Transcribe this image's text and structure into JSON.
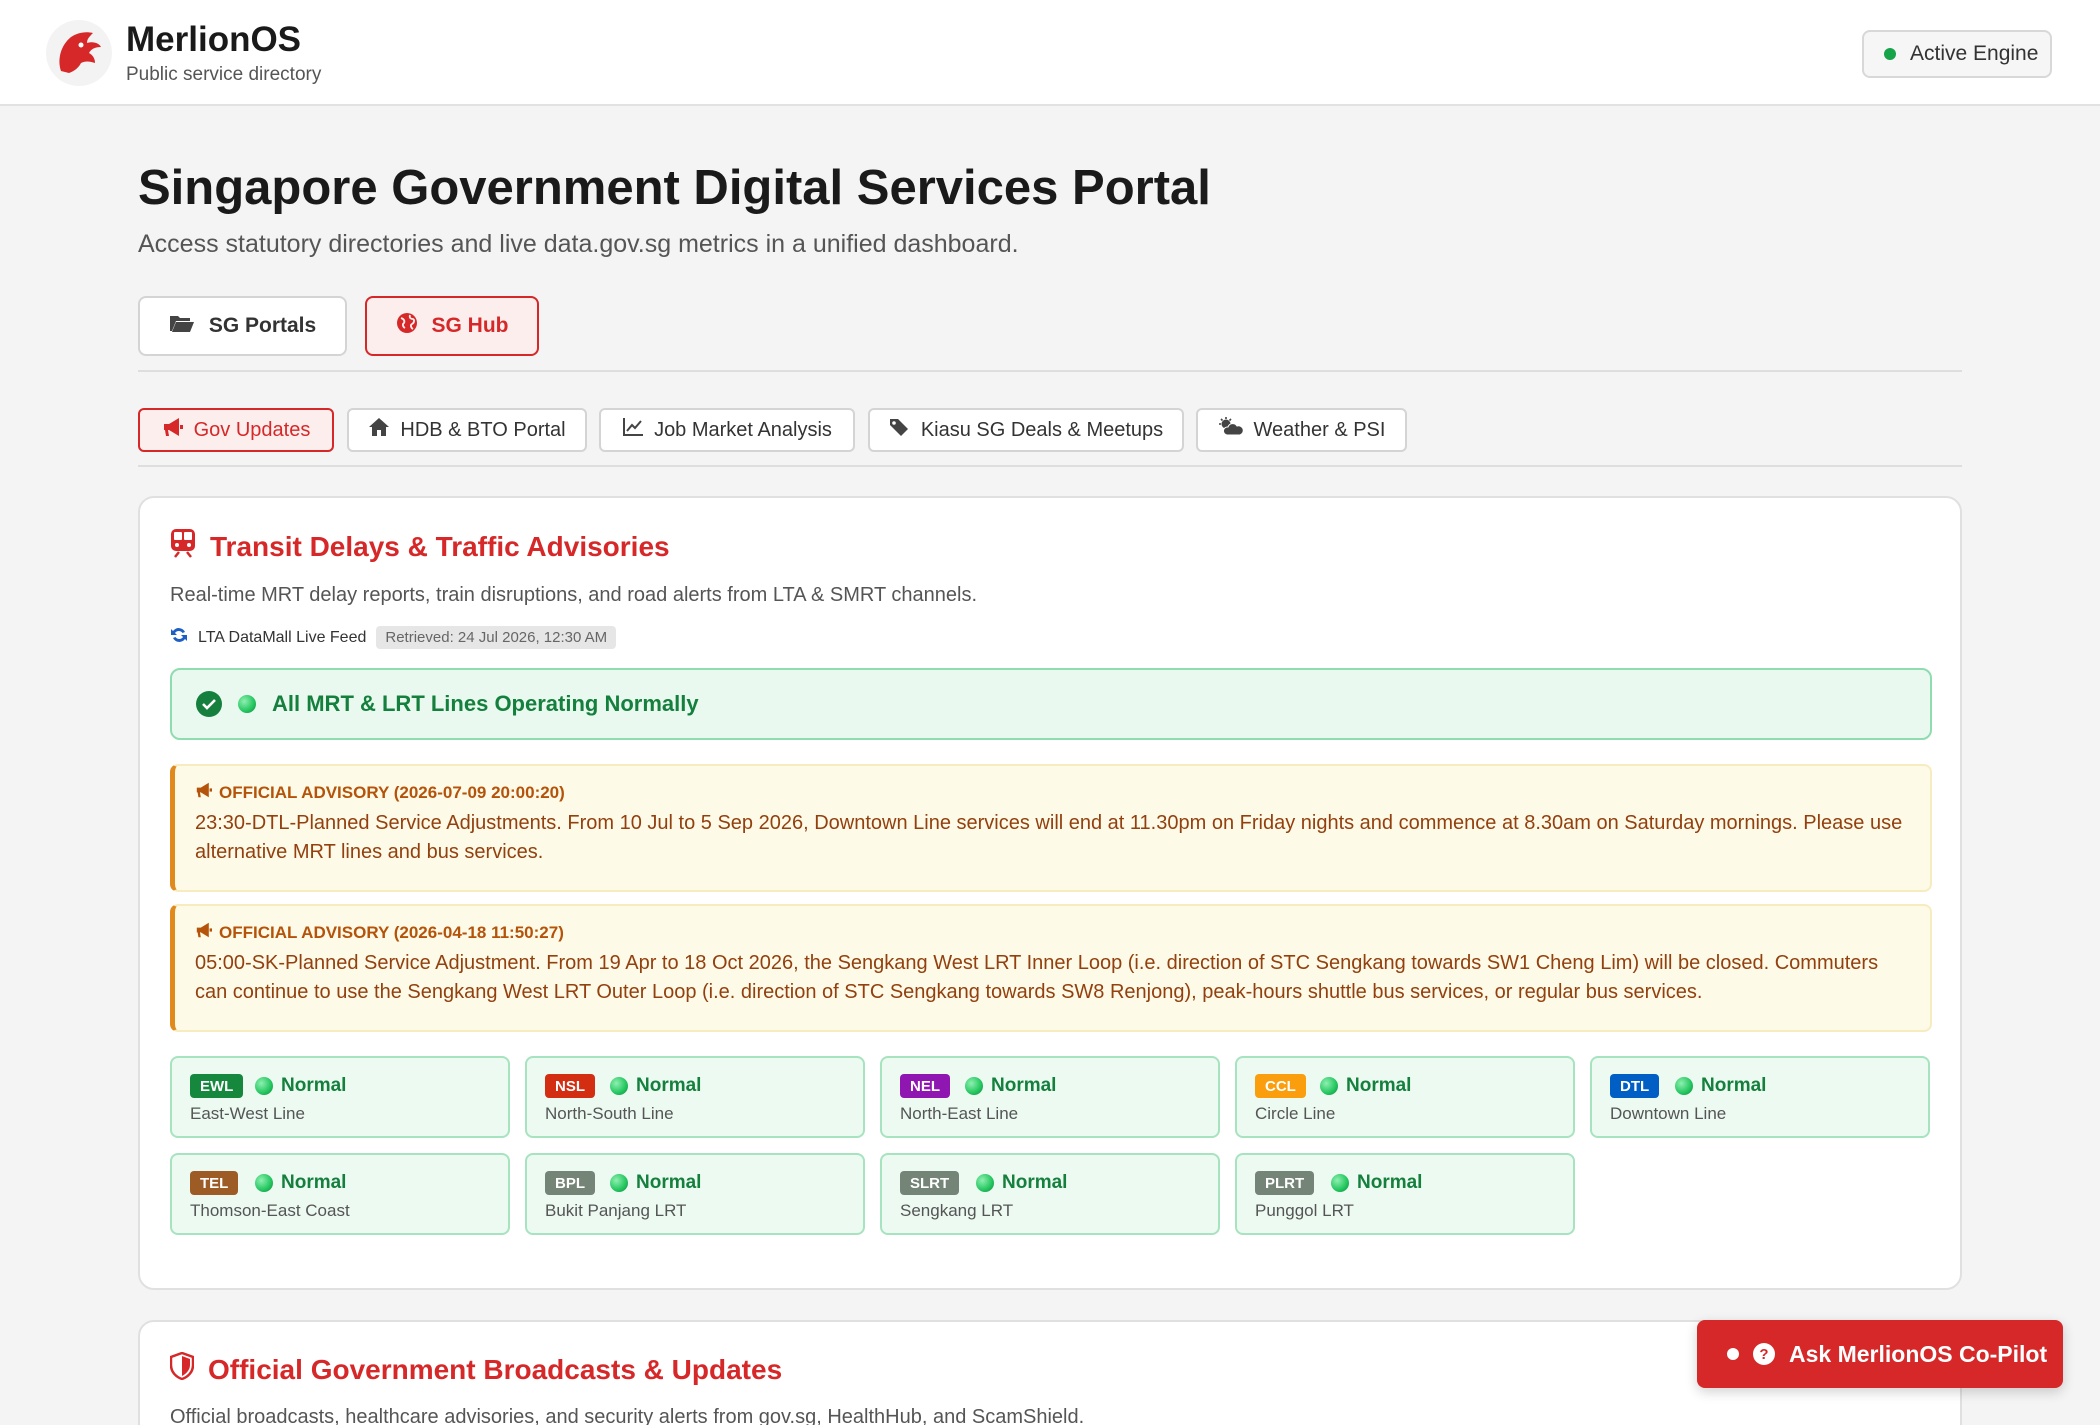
{
  "header": {
    "brand_name": "MerlionOS",
    "brand_sub": "Public service directory",
    "engine_label": "Active Engine"
  },
  "page": {
    "title": "Singapore Government Digital Services Portal",
    "subtitle": "Access statutory directories and live data.gov.sg metrics in a unified dashboard."
  },
  "main_tabs": [
    {
      "label": "SG Portals",
      "icon": "folder-open-icon",
      "active": false
    },
    {
      "label": "SG Hub",
      "icon": "globe-icon",
      "active": true
    }
  ],
  "sub_tabs": [
    {
      "label": "Gov Updates",
      "icon": "megaphone-icon",
      "active": true
    },
    {
      "label": "HDB & BTO Portal",
      "icon": "home-icon",
      "active": false
    },
    {
      "label": "Job Market Analysis",
      "icon": "line-chart-icon",
      "active": false
    },
    {
      "label": "Kiasu SG Deals & Meetups",
      "icon": "tags-icon",
      "active": false
    },
    {
      "label": "Weather & PSI",
      "icon": "cloud-sun-icon",
      "active": false
    }
  ],
  "transit": {
    "title": "Transit Delays & Traffic Advisories",
    "description": "Real-time MRT delay reports, train disruptions, and road alerts from LTA & SMRT channels.",
    "feed_label": "LTA DataMall Live Feed",
    "retrieved": "Retrieved: 24 Jul 2026, 12:30 AM",
    "overall_status": "All MRT & LRT Lines Operating Normally",
    "advisories": [
      {
        "header": "OFFICIAL ADVISORY (2026-07-09 20:00:20)",
        "body": "23:30-DTL-Planned Service Adjustments. From 10 Jul to 5 Sep 2026, Downtown Line services will end at 11.30pm on Friday nights and commence at 8.30am on Saturday mornings. Please use alternative MRT lines and bus services."
      },
      {
        "header": "OFFICIAL ADVISORY (2026-04-18 11:50:27)",
        "body": "05:00-SK-Planned Service Adjustment. From 19 Apr to 18 Oct 2026, the Sengkang West LRT Inner Loop (i.e. direction of STC Sengkang towards SW1 Cheng Lim) will be closed. Commuters can continue to use the Sengkang West LRT Outer Loop (i.e. direction of STC Sengkang towards SW8 Renjong), peak-hours shuttle bus services, or regular bus services."
      }
    ],
    "lines": [
      {
        "code": "EWL",
        "status": "Normal",
        "name": "East-West Line",
        "color": "#16883e"
      },
      {
        "code": "NSL",
        "status": "Normal",
        "name": "North-South Line",
        "color": "#d42e12"
      },
      {
        "code": "NEL",
        "status": "Normal",
        "name": "North-East Line",
        "color": "#9016b2"
      },
      {
        "code": "CCL",
        "status": "Normal",
        "name": "Circle Line",
        "color": "#fa9e0d"
      },
      {
        "code": "DTL",
        "status": "Normal",
        "name": "Downtown Line",
        "color": "#005ec4"
      },
      {
        "code": "TEL",
        "status": "Normal",
        "name": "Thomson-East Coast",
        "color": "#9d5b25"
      },
      {
        "code": "BPL",
        "status": "Normal",
        "name": "Bukit Panjang LRT",
        "color": "#748477"
      },
      {
        "code": "SLRT",
        "status": "Normal",
        "name": "Sengkang LRT",
        "color": "#748477"
      },
      {
        "code": "PLRT",
        "status": "Normal",
        "name": "Punggol LRT",
        "color": "#748477"
      }
    ]
  },
  "broadcasts": {
    "title": "Official Government Broadcasts & Updates",
    "description": "Official broadcasts, healthcare advisories, and security alerts from gov.sg, HealthHub, and ScamShield."
  },
  "copilot": {
    "label": "Ask MerlionOS Co-Pilot"
  },
  "colors": {
    "accent": "#d62828",
    "success": "#15803d",
    "warning": "#b45309"
  }
}
